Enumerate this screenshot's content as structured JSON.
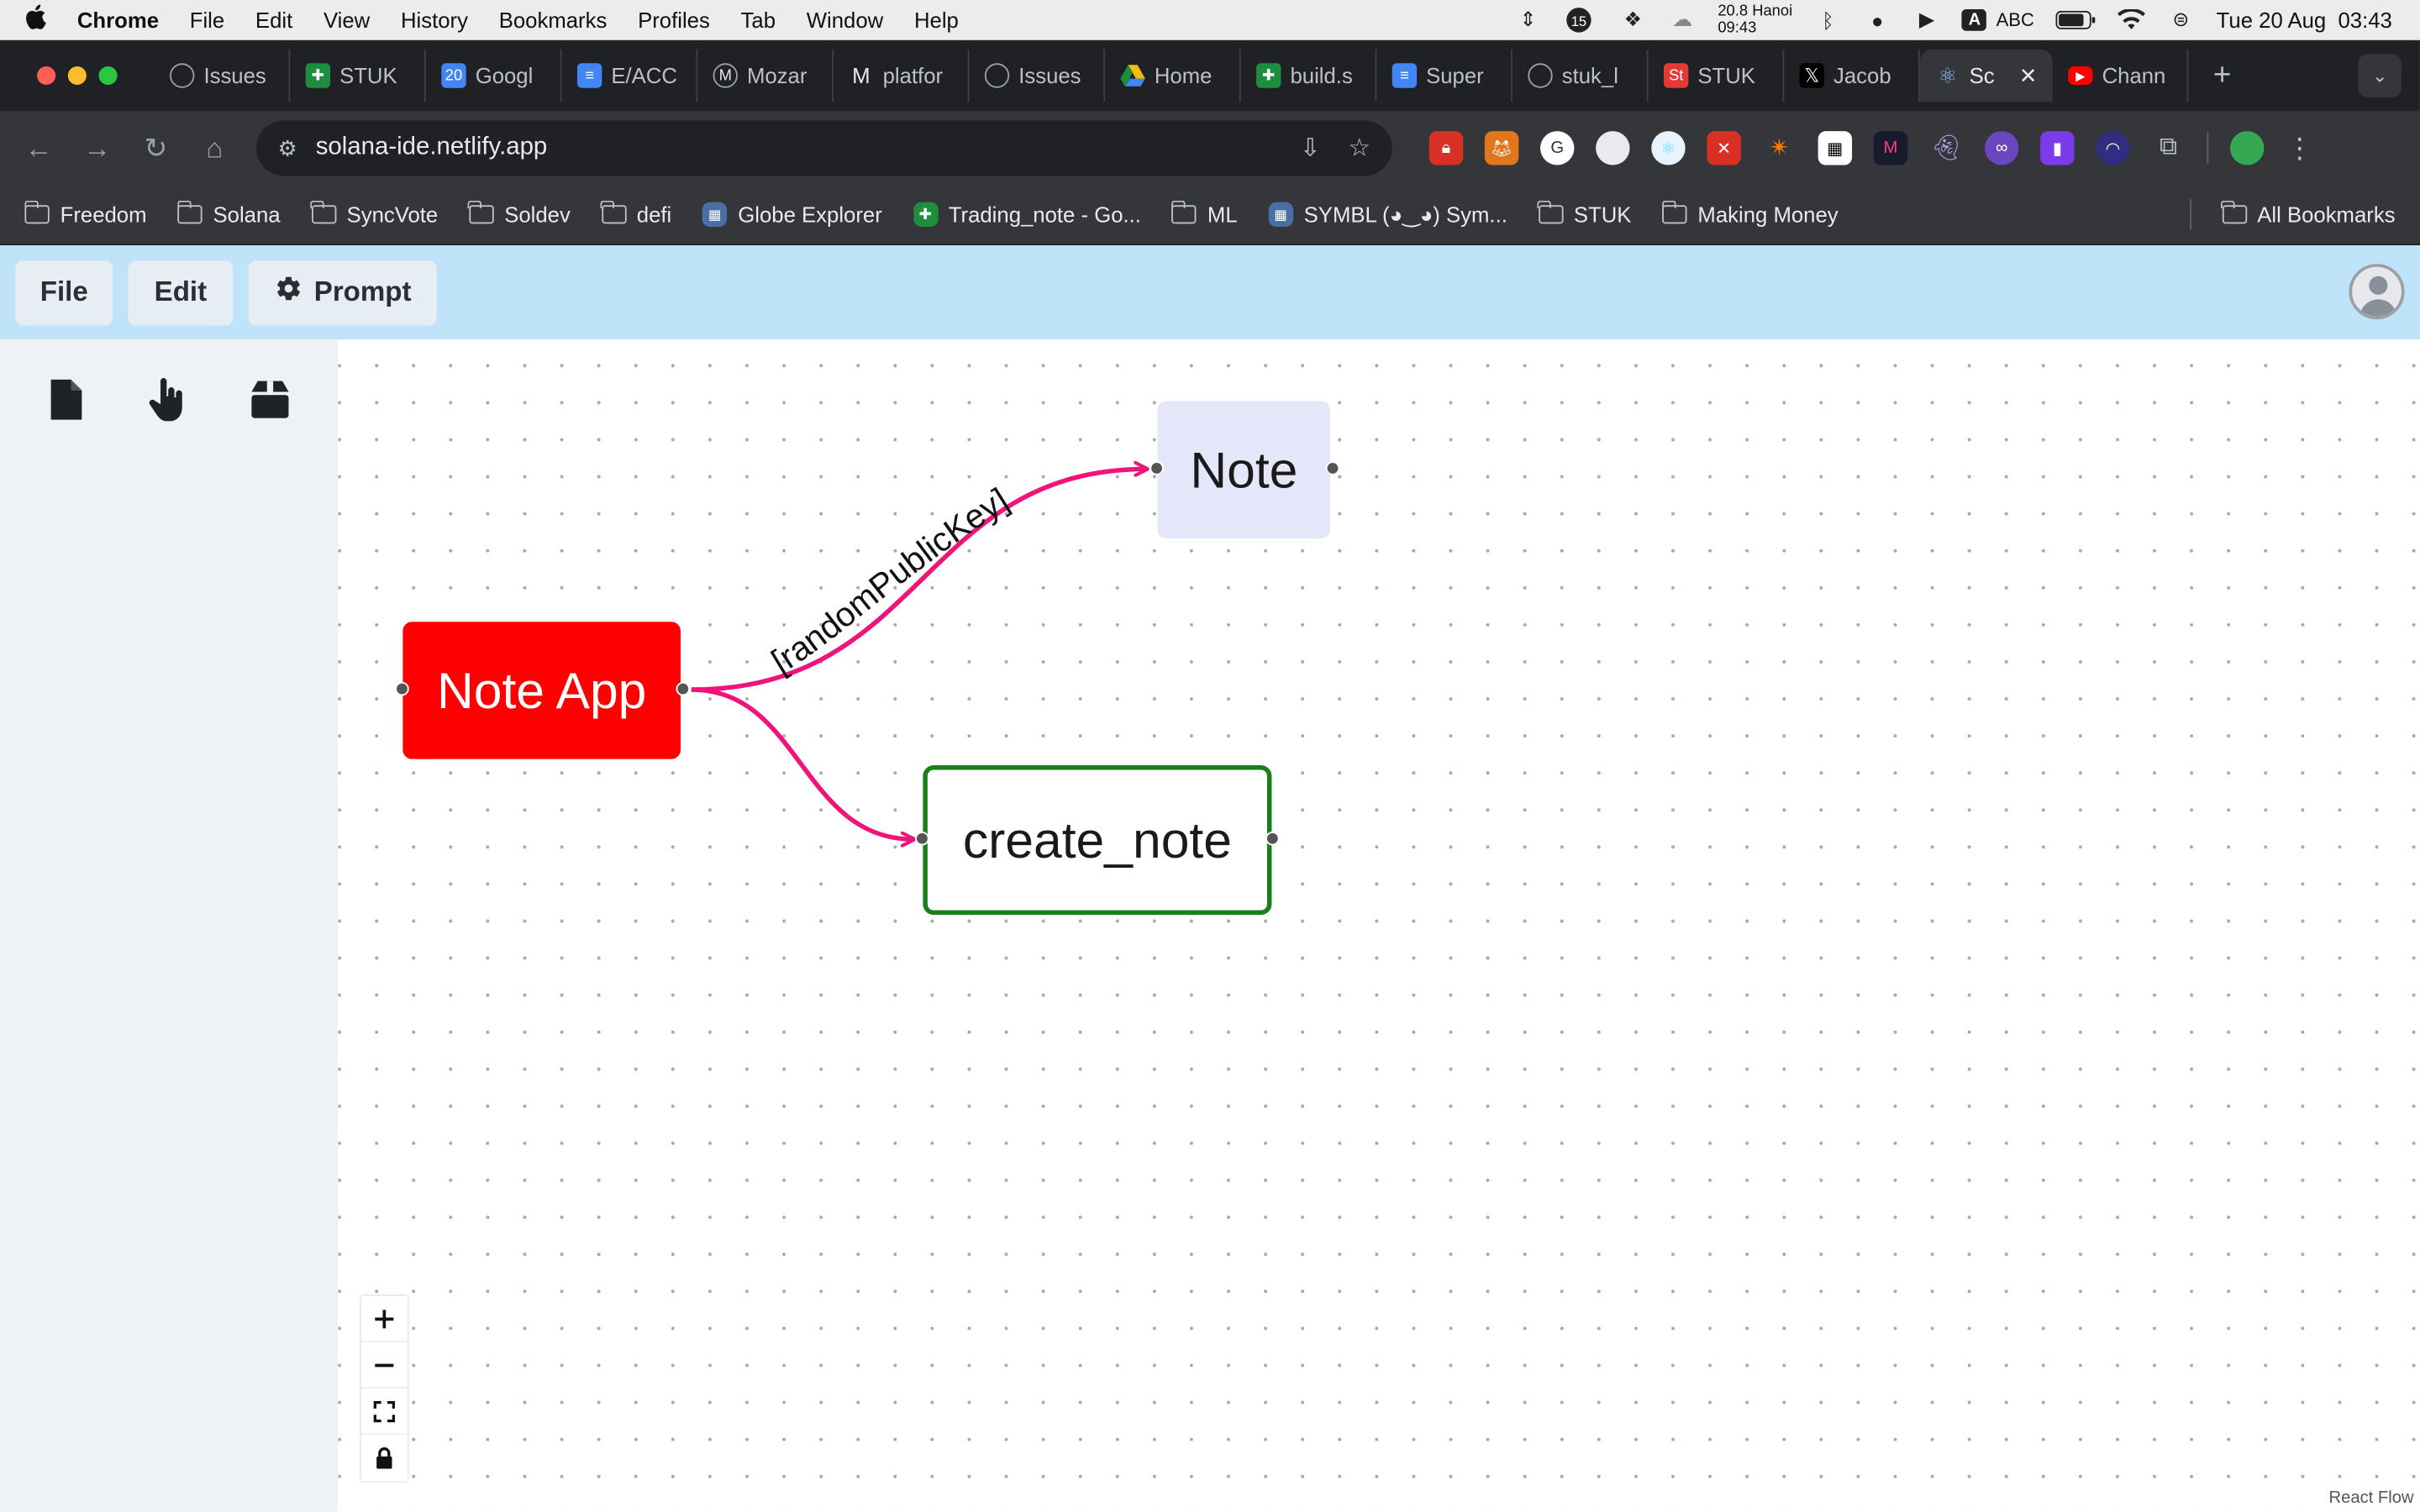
{
  "menubar": {
    "items": [
      "Chrome",
      "File",
      "Edit",
      "View",
      "History",
      "Bookmarks",
      "Profiles",
      "Tab",
      "Window",
      "Help"
    ],
    "weather_temp": "20.8",
    "weather_city": "Hanoi",
    "weather_time": "09:43",
    "input_source": "ABC",
    "input_badge": "A",
    "notification_count": "15",
    "datetime": "Tue 20 Aug  03:43"
  },
  "tabs": [
    {
      "title": "Issues",
      "icon": "spinner-icon",
      "color": "#3c4043"
    },
    {
      "title": "STUK",
      "icon": "sheets-icon",
      "color": "#1e8e3e"
    },
    {
      "title": "Googl",
      "icon": "calendar-icon",
      "color": "#4285f4",
      "badge": "20"
    },
    {
      "title": "E/ACC",
      "icon": "docs-icon",
      "color": "#4285f4"
    },
    {
      "title": "Mozar",
      "icon": "m-circle-icon",
      "color": "#3c4043"
    },
    {
      "title": "platfor",
      "icon": "m-icon",
      "color": "#3c4043"
    },
    {
      "title": "Issues",
      "icon": "spinner-icon",
      "color": "#3c4043"
    },
    {
      "title": "Home",
      "icon": "drive-icon",
      "color": "#fbbc04"
    },
    {
      "title": "build.s",
      "icon": "sheets-icon",
      "color": "#1e8e3e"
    },
    {
      "title": "Super",
      "icon": "docs-icon",
      "color": "#4285f4"
    },
    {
      "title": "stuk_l",
      "icon": "spinner-icon",
      "color": "#3c4043"
    },
    {
      "title": "STUK",
      "icon": "st-icon",
      "color": "#e53935"
    },
    {
      "title": "Jacob",
      "icon": "x-icon",
      "color": "#000000"
    },
    {
      "title": "Sc",
      "icon": "react-icon",
      "color": "#35363a",
      "active": true
    },
    {
      "title": "Chann",
      "icon": "youtube-icon",
      "color": "#ff0000"
    }
  ],
  "address_bar": {
    "url": "solana-ide.netlify.app"
  },
  "bookmarks": [
    {
      "label": "Freedom",
      "type": "folder"
    },
    {
      "label": "Solana",
      "type": "folder"
    },
    {
      "label": "SyncVote",
      "type": "folder"
    },
    {
      "label": "Soldev",
      "type": "folder"
    },
    {
      "label": "defi",
      "type": "folder"
    },
    {
      "label": "Globe Explorer",
      "type": "site"
    },
    {
      "label": "Trading_note - Go...",
      "type": "sheet"
    },
    {
      "label": "ML",
      "type": "folder"
    },
    {
      "label": "SYMBL (◕‿◕) Sym...",
      "type": "site"
    },
    {
      "label": "STUK",
      "type": "folder"
    },
    {
      "label": "Making Money",
      "type": "folder"
    }
  ],
  "all_bookmarks_label": "All Bookmarks",
  "app_header": {
    "file_label": "File",
    "edit_label": "Edit",
    "prompt_label": "Prompt"
  },
  "sidebar_tools": [
    "file-icon",
    "hand-pointer-icon",
    "box-icon"
  ],
  "flow": {
    "nodes": [
      {
        "id": "note-app",
        "label": "Note App",
        "fill": "#ff0000",
        "text_color": "#ffffff"
      },
      {
        "id": "note",
        "label": "Note",
        "fill": "#e6e6fa",
        "text_color": "#1a1a1a"
      },
      {
        "id": "create-note",
        "label": "create_note",
        "fill": "#ffffff",
        "border": "#1a7f1a",
        "text_color": "#1a1a1a"
      }
    ],
    "edges": [
      {
        "from": "note-app",
        "to": "note",
        "label": "[randomPublicKey]",
        "color": "#f0147a"
      },
      {
        "from": "note-app",
        "to": "create-note",
        "label": "",
        "color": "#f0147a"
      }
    ]
  },
  "controls": [
    "zoom-in",
    "zoom-out",
    "fit-view",
    "lock"
  ],
  "attribution": "React Flow"
}
